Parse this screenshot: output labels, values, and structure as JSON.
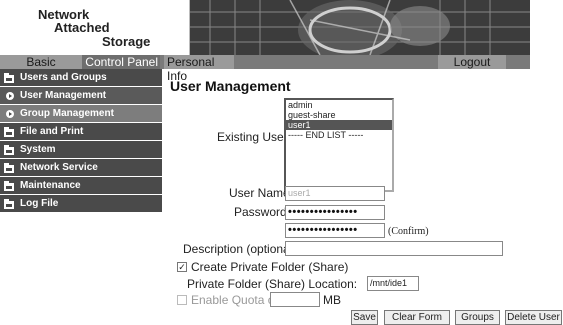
{
  "header": {
    "logo_line1": "Network",
    "logo_line2": "Attached",
    "logo_line3": "Storage"
  },
  "tabs": {
    "basic": "Basic",
    "control_panel": "Control Panel",
    "personal_info": "Personal Info",
    "logout": "Logout"
  },
  "sidebar": {
    "items": [
      {
        "label": "Users and Groups",
        "icon": "folder-icon"
      },
      {
        "label": "User Management",
        "icon": "bullet-arrow-icon"
      },
      {
        "label": "Group Management",
        "icon": "bullet-arrow-icon"
      },
      {
        "label": "File and Print",
        "icon": "folder-icon"
      },
      {
        "label": "System",
        "icon": "folder-icon"
      },
      {
        "label": "Network Service",
        "icon": "folder-icon"
      },
      {
        "label": "Maintenance",
        "icon": "folder-icon"
      },
      {
        "label": "Log File",
        "icon": "folder-icon"
      }
    ]
  },
  "main": {
    "title": "User Management",
    "existing_users_label": "Existing Users",
    "existing_users": [
      "admin",
      "guest-share",
      "user1",
      "----- END LIST -----"
    ],
    "selected_user": "user1",
    "user_name_label": "User Name",
    "user_name_value": "user1",
    "password_label": "Password",
    "password_mask": "••••••••••••••••",
    "confirm_mask": "••••••••••••••••",
    "confirm_label": "(Confirm)",
    "description_label": "Description (optional)",
    "description_value": "",
    "create_folder_label": "Create Private Folder (Share)",
    "create_folder_checked": true,
    "folder_location_label": "Private Folder (Share) Location:",
    "folder_location_value": "/mnt/ide1",
    "enable_quota_label": "Enable Quota of",
    "quota_value": "",
    "quota_unit": "MB",
    "buttons": {
      "save": "Save",
      "clear_form": "Clear Form",
      "groups": "Groups",
      "delete_user": "Delete User"
    }
  },
  "colors": {
    "sidebar_dark": "#4a4a4a",
    "sidebar_sub": "#7d7d7d",
    "tab_bar": "#7a7a7a",
    "listbox_selected": "#555555"
  }
}
